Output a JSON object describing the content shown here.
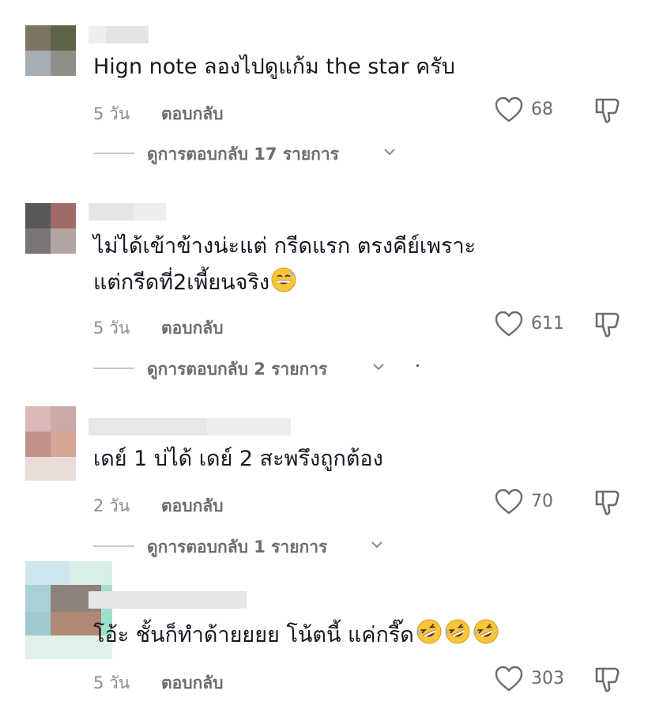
{
  "colors": {
    "text": "#161823",
    "meta": "#8a8b91",
    "action": "#6b6c72",
    "divider": "#c8c9cc"
  },
  "comments": [
    {
      "text_lines": [
        "Hign note ลองไปดูแก้ม the star ครับ"
      ],
      "emojis": [],
      "date": "5 วัน",
      "reply_label": "ตอบกลับ",
      "likes": "68",
      "replies_label": "ดูการตอบกลับ 17 รายการ"
    },
    {
      "text_lines": [
        "ไม่ได้เข้าข้างน่ะแต่  กรีดแรก ตรงคีย์เพราะ",
        "แต่กรีดที่2เพี้ยนจริง"
      ],
      "emojis": [
        "grinning-sweat-emoji"
      ],
      "date": "5 วัน",
      "reply_label": "ตอบกลับ",
      "likes": "611",
      "replies_label": "ดูการตอบกลับ 2 รายการ"
    },
    {
      "text_lines": [
        "เดย์ 1 บ่ได้ เดย์ 2 สะพรึงถูกต้อง"
      ],
      "emojis": [],
      "date": "2 วัน",
      "reply_label": "ตอบกลับ",
      "likes": "70",
      "replies_label": "ดูการตอบกลับ 1 รายการ"
    },
    {
      "text_lines": [
        "โอ้ะ ชั้นก็ทำด้ายยยย โน้ตนี้ แค่กรี๊ด"
      ],
      "emojis": [
        "rofl-emoji",
        "rofl-emoji",
        "rofl-emoji"
      ],
      "date": "5 วัน",
      "reply_label": "ตอบกลับ",
      "likes": "303",
      "replies_label": ""
    }
  ],
  "icons": {
    "like": "heart-outline-icon",
    "dislike": "thumbs-down-icon",
    "expand": "chevron-down-icon"
  }
}
